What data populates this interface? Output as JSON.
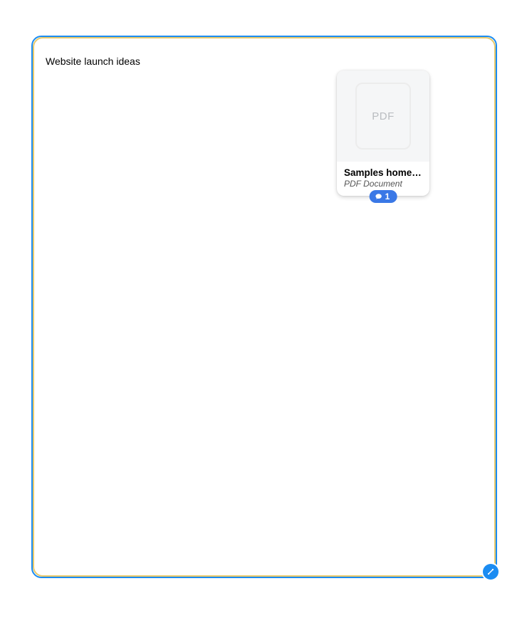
{
  "title": "Website launch ideas",
  "file_card": {
    "thumb_label": "PDF",
    "name": "Samples home page.pdf",
    "type_label": "PDF Document",
    "comment_count": "1"
  }
}
